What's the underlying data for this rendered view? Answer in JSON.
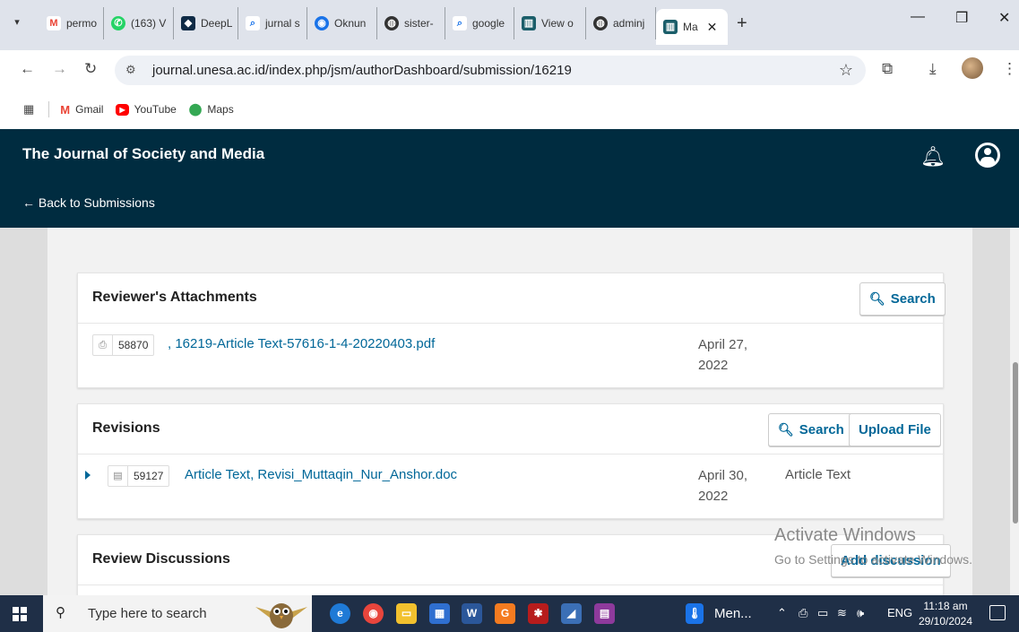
{
  "browser": {
    "tabs": [
      {
        "label": "permo",
        "icon": "gmail-icon",
        "color": "#ea4335",
        "glyph": "M"
      },
      {
        "label": "(163) V",
        "icon": "whatsapp-icon",
        "color": "#25d366",
        "glyph": "✆"
      },
      {
        "label": "DeepL",
        "icon": "deepl-icon",
        "color": "#0f2b46",
        "glyph": "◆"
      },
      {
        "label": "jurnal s",
        "icon": "search-icon",
        "color": "#1a73e8",
        "glyph": "⌕"
      },
      {
        "label": "Oknun",
        "icon": "turnitin-icon",
        "color": "#1a73e8",
        "glyph": "◉"
      },
      {
        "label": "sister-",
        "icon": "globe-icon",
        "color": "#333333",
        "glyph": "◍"
      },
      {
        "label": "google",
        "icon": "search-icon",
        "color": "#1a73e8",
        "glyph": "⌕"
      },
      {
        "label": "View o",
        "icon": "journal-icon",
        "color": "#1b5e6a",
        "glyph": "▥"
      },
      {
        "label": "adminj",
        "icon": "globe-icon",
        "color": "#333333",
        "glyph": "◍"
      }
    ],
    "active_tab": {
      "label": "Ma",
      "icon": "journal-icon",
      "color": "#1b5e6a",
      "glyph": "▥"
    },
    "url": "journal.unesa.ac.id/index.php/jsm/authorDashboard/submission/16219",
    "bookmarks": [
      {
        "label": "Gmail",
        "icon": "gmail-icon",
        "glyph": "M",
        "color": "#ea4335"
      },
      {
        "label": "YouTube",
        "icon": "youtube-icon",
        "glyph": "▶",
        "color": "#ff0000"
      },
      {
        "label": "Maps",
        "icon": "maps-icon",
        "glyph": "●",
        "color": "#34a853"
      }
    ]
  },
  "header": {
    "journal_title": "The Journal of Society and Media",
    "back_link": "← Back to Submissions"
  },
  "reviewer_attachments": {
    "title": "Reviewer's Attachments",
    "search_label": "Search",
    "files": [
      {
        "id": "58870",
        "name": ", 16219-Article Text-57616-1-4-20220403.pdf",
        "date_line1": "April 27,",
        "date_line2": "2022",
        "type": ""
      }
    ]
  },
  "revisions": {
    "title": "Revisions",
    "search_label": "Search",
    "upload_label": "Upload File",
    "files": [
      {
        "id": "59127",
        "name": "Article Text, Revisi_Muttaqin_Nur_Anshor.doc",
        "date_line1": "April 30,",
        "date_line2": "2022",
        "type": "Article Text"
      }
    ]
  },
  "review_discussions": {
    "title": "Review Discussions",
    "add_label": "Add discussion"
  },
  "watermark": {
    "line1": "Activate Windows",
    "line2": "Go to Settings to activate Windows."
  },
  "taskbar": {
    "search_placeholder": "Type here to search",
    "running_app_label": "Men...",
    "language": "ENG",
    "time": "11:18 am",
    "date": "29/10/2024"
  },
  "colors": {
    "header_bg": "#002c40",
    "link": "#006798",
    "taskbar_bg": "#1f2f47"
  }
}
